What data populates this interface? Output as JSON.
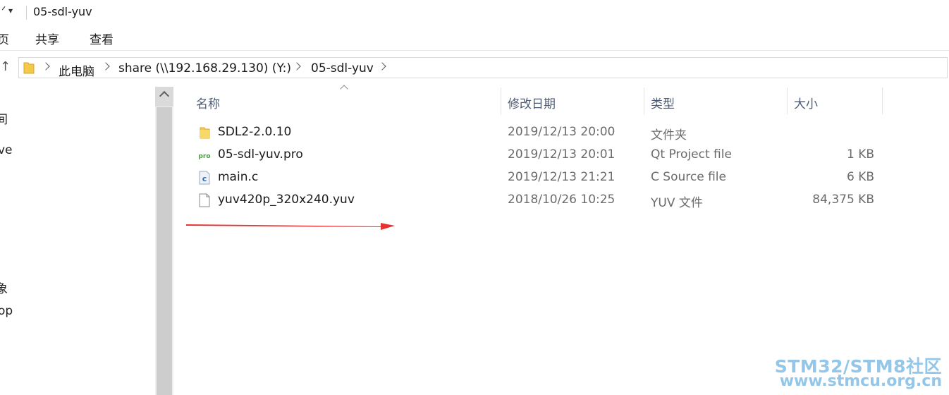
{
  "window": {
    "title": "05-sdl-yuv"
  },
  "ribbon": {
    "tabs": [
      "页",
      "共享",
      "查看"
    ]
  },
  "address": {
    "crumbs": [
      "此电脑",
      "share (\\\\192.168.29.130) (Y:)",
      "05-sdl-yuv"
    ]
  },
  "nav": {
    "fragments": [
      "间",
      "ve",
      "象",
      "op"
    ]
  },
  "columns": {
    "name": "名称",
    "date": "修改日期",
    "type": "类型",
    "size": "大小"
  },
  "files": [
    {
      "name": "SDL2-2.0.10",
      "date": "2019/12/13 20:00",
      "type": "文件夹",
      "size": "",
      "icon": "folder-icon"
    },
    {
      "name": "05-sdl-yuv.pro",
      "date": "2019/12/13 20:01",
      "type": "Qt Project file",
      "size": "1 KB",
      "icon": "qt-pro-icon"
    },
    {
      "name": "main.c",
      "date": "2019/12/13 21:21",
      "type": "C Source file",
      "size": "6 KB",
      "icon": "c-source-icon"
    },
    {
      "name": "yuv420p_320x240.yuv",
      "date": "2018/10/26 10:25",
      "type": "YUV 文件",
      "size": "84,375 KB",
      "icon": "blank-file-icon"
    }
  ],
  "watermark": {
    "line1": "STM32/STM8社区",
    "line2": "www.stmcu.org.cn"
  },
  "colors": {
    "folder": "#f4c94a",
    "arrow": "#e83232",
    "watermark": "#93c6e8",
    "header_text": "#4c5b75"
  }
}
